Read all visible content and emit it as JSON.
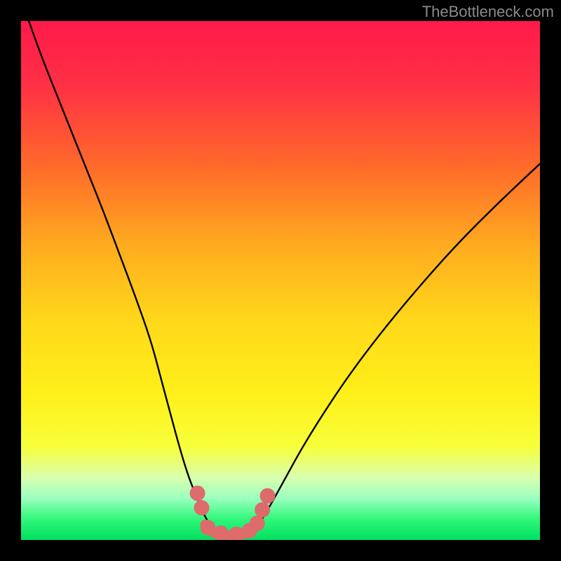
{
  "watermark": "TheBottleneck.com",
  "chart_data": {
    "type": "line",
    "title": "",
    "xlabel": "",
    "ylabel": "",
    "xlim": [
      0,
      100
    ],
    "ylim": [
      0,
      100
    ],
    "gradient_stops": [
      {
        "offset": 0.0,
        "color": "#ff1a4a"
      },
      {
        "offset": 0.12,
        "color": "#ff2f45"
      },
      {
        "offset": 0.28,
        "color": "#ff6a2a"
      },
      {
        "offset": 0.44,
        "color": "#ffae1f"
      },
      {
        "offset": 0.58,
        "color": "#ffd81a"
      },
      {
        "offset": 0.72,
        "color": "#fff01a"
      },
      {
        "offset": 0.82,
        "color": "#f7ff3a"
      },
      {
        "offset": 0.88,
        "color": "#d9ffb0"
      },
      {
        "offset": 0.92,
        "color": "#9affc0"
      },
      {
        "offset": 0.96,
        "color": "#30f77a"
      },
      {
        "offset": 1.0,
        "color": "#00e060"
      }
    ],
    "series": [
      {
        "name": "left-curve",
        "stroke": "#000000",
        "x": [
          1.5,
          4,
          7,
          10,
          13,
          16,
          19,
          22,
          25,
          27,
          29,
          30.5,
          32,
          33.5,
          35,
          36,
          37
        ],
        "y": [
          100,
          93,
          85.5,
          78,
          70.5,
          63,
          55,
          47,
          38.5,
          31,
          23.5,
          18,
          13,
          9,
          5.5,
          3.5,
          2
        ]
      },
      {
        "name": "right-curve",
        "stroke": "#000000",
        "x": [
          45,
          46.5,
          48.5,
          51,
          54,
          58,
          63,
          69,
          76,
          84,
          92,
          100
        ],
        "y": [
          2,
          4,
          7.5,
          12,
          17.5,
          24,
          31.5,
          39.5,
          48,
          57,
          65,
          72.5
        ]
      },
      {
        "name": "bottom-connector",
        "stroke": "#dd6b6b",
        "stroke_width": 14,
        "x": [
          35.5,
          36.5,
          38.5,
          40.5,
          42.5,
          44,
          45.5
        ],
        "y": [
          3.0,
          1.6,
          0.9,
          0.8,
          0.9,
          1.5,
          2.8
        ]
      }
    ],
    "markers": {
      "name": "salmon-dots",
      "color": "#dd6b6b",
      "radius": 11,
      "points": [
        {
          "x": 34.0,
          "y": 9.0
        },
        {
          "x": 34.8,
          "y": 6.2
        },
        {
          "x": 36.0,
          "y": 2.4
        },
        {
          "x": 38.5,
          "y": 1.3
        },
        {
          "x": 41.5,
          "y": 1.1
        },
        {
          "x": 44.0,
          "y": 1.8
        },
        {
          "x": 45.5,
          "y": 3.2
        },
        {
          "x": 46.5,
          "y": 5.8
        },
        {
          "x": 47.5,
          "y": 8.5
        }
      ]
    }
  }
}
